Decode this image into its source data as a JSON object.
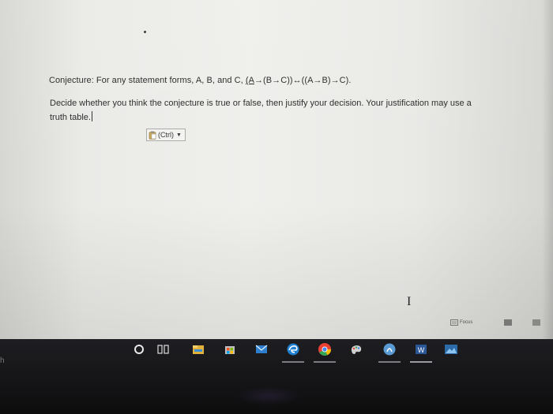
{
  "document": {
    "conjecture_intro": "Conjecture: For any statement forms, A, B, and C, ",
    "expr_underlined": "(A",
    "expr_rest": "→(B→C))↔((A→B)→C).",
    "decide_text": "Decide whether you think the conjecture is true or false, then justify your decision.  Your justification may use a truth table."
  },
  "paste_options": {
    "label": "(Ctrl)",
    "icon": "clipboard-icon",
    "dropdown_icon": "chevron-down-icon"
  },
  "status_bar": {
    "focus_label": "Focus"
  },
  "taskbar": {
    "left_text": "h",
    "items": [
      {
        "name": "cortana-icon"
      },
      {
        "name": "task-view-icon"
      },
      {
        "name": "file-explorer-icon"
      },
      {
        "name": "store-icon"
      },
      {
        "name": "mail-icon"
      },
      {
        "name": "edge-icon"
      },
      {
        "name": "chrome-icon"
      },
      {
        "name": "paint-icon"
      },
      {
        "name": "app-icon"
      },
      {
        "name": "word-icon"
      },
      {
        "name": "photos-icon"
      }
    ]
  }
}
